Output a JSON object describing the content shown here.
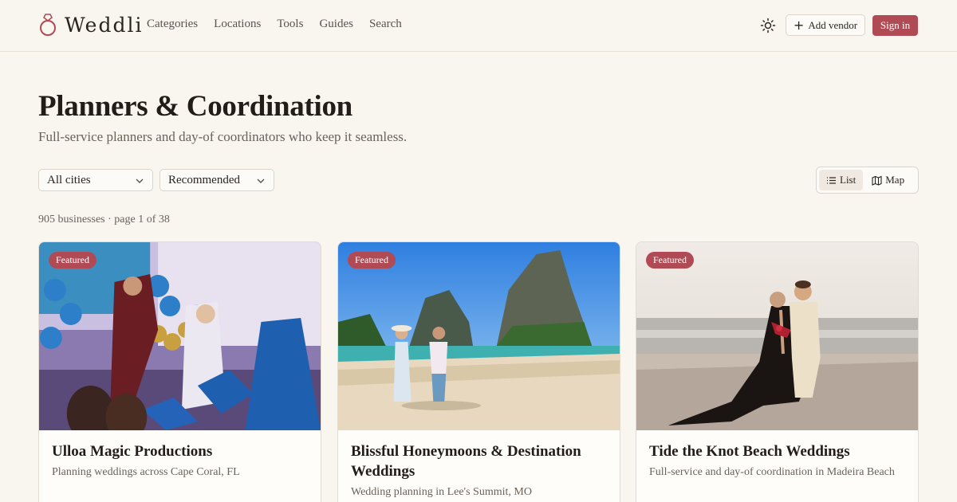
{
  "brand": {
    "name": "Weddli",
    "accent": "#b04a55"
  },
  "nav": {
    "items": [
      "Categories",
      "Locations",
      "Tools",
      "Guides",
      "Search"
    ]
  },
  "header": {
    "add_vendor": "Add vendor",
    "sign_in": "Sign in",
    "theme_icon": "sun-icon"
  },
  "page": {
    "title": "Planners & Coordination",
    "subtitle": "Full-service planners and day-of coordinators who keep it seamless."
  },
  "filters": {
    "city": "All cities",
    "sort": "Recommended"
  },
  "view_toggle": {
    "list": "List",
    "map": "Map",
    "active": "List"
  },
  "results": {
    "summary": "905 businesses · page 1 of 38"
  },
  "cards": [
    {
      "badge": "Featured",
      "title": "Ulloa Magic Productions",
      "desc": "Planning weddings across Cape Coral, FL"
    },
    {
      "badge": "Featured",
      "title": "Blissful Honeymoons & Destination Weddings",
      "desc": "Wedding planning in Lee's Summit, MO"
    },
    {
      "badge": "Featured",
      "title": "Tide the Knot Beach Weddings",
      "desc": "Full-service and day-of coordination in Madeira Beach"
    }
  ]
}
